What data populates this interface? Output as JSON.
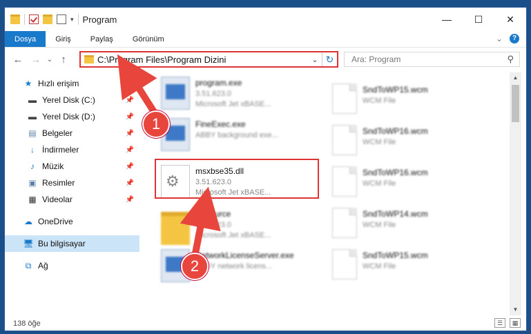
{
  "window": {
    "title": "Program",
    "controls": {
      "minimize": "—",
      "maximize": "☐",
      "close": "✕"
    }
  },
  "ribbon": {
    "tabs": [
      {
        "label": "Dosya"
      },
      {
        "label": "Giriş"
      },
      {
        "label": "Paylaş"
      },
      {
        "label": "Görünüm"
      }
    ],
    "expand": "⌄",
    "help": "?"
  },
  "nav": {
    "back": "←",
    "forward": "→",
    "recent": "⌄",
    "up": "↑",
    "address": "C:\\Program Files\\Program Dizini",
    "search_placeholder": "Ara: Program"
  },
  "sidebar": {
    "items": [
      {
        "label": "Hızlı erişim",
        "icon": "star-icon"
      },
      {
        "label": "Yerel Disk (C:)",
        "icon": "drive-icon",
        "pinned": true
      },
      {
        "label": "Yerel Disk (D:)",
        "icon": "drive-icon",
        "pinned": true
      },
      {
        "label": "Belgeler",
        "icon": "documents-icon",
        "pinned": true
      },
      {
        "label": "İndirmeler",
        "icon": "download-icon",
        "pinned": true
      },
      {
        "label": "Müzik",
        "icon": "music-icon",
        "pinned": true
      },
      {
        "label": "Resimler",
        "icon": "pictures-icon",
        "pinned": true
      },
      {
        "label": "Videolar",
        "icon": "video-icon",
        "pinned": true
      },
      {
        "label": "OneDrive",
        "icon": "cloud-icon"
      },
      {
        "label": "Bu bilgisayar",
        "icon": "computer-icon",
        "selected": true
      },
      {
        "label": "Ağ",
        "icon": "network-icon"
      }
    ]
  },
  "files": [
    {
      "name": "program.exe",
      "sub1": "3.51.623.0",
      "sub2": "Microsoft Jet xBASE...",
      "icon": "exe-icon"
    },
    {
      "name": "FineExec.exe",
      "sub1": "ABBY background exe...",
      "sub2": "",
      "icon": "exe-icon"
    },
    {
      "name": "msxbse35.dll",
      "sub1": "3.51.623.0",
      "sub2": "Microsoft Jet xBASE...",
      "icon": "gear-file-icon"
    },
    {
      "name": "Resource",
      "sub1": "3.51.623.0",
      "sub2": "Microsoft Jet xBASE...",
      "icon": "folder-icon"
    },
    {
      "name": "NetworkLicenseServer.exe",
      "sub1": "ABBY network licens...",
      "sub2": "",
      "icon": "exe-icon"
    },
    {
      "name": "SndToWP15.wcm",
      "sub1": "WCM File",
      "sub2": "",
      "icon": "document-icon"
    },
    {
      "name": "SndToWP16.wcm",
      "sub1": "WCM File",
      "sub2": "",
      "icon": "document-icon"
    },
    {
      "name": "SndToWP16.wcm",
      "sub1": "WCM File",
      "sub2": "",
      "icon": "document-icon"
    },
    {
      "name": "SndToWP14.wcm",
      "sub1": "WCM File",
      "sub2": "",
      "icon": "document-icon"
    },
    {
      "name": "SndToWP15.wcm",
      "sub1": "WCM File",
      "sub2": "",
      "icon": "document-icon"
    }
  ],
  "annotations": {
    "step1": "1",
    "step2": "2"
  },
  "status": {
    "count": "138 öğe"
  },
  "colors": {
    "accent": "#1979ca",
    "highlight": "#d33333",
    "selected": "#cce4f7"
  }
}
